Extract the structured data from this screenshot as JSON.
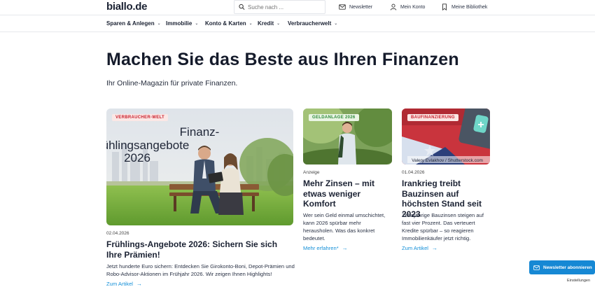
{
  "header": {
    "logo": "biallo.de",
    "search_placeholder": "Suche nach ...",
    "links": [
      {
        "label": "Newsletter",
        "icon": "mail-icon"
      },
      {
        "label": "Mein Konto",
        "icon": "user-icon"
      },
      {
        "label": "Meine Bibliothek",
        "icon": "bookmark-icon"
      }
    ]
  },
  "nav": [
    {
      "label": "Sparen & Anlegen"
    },
    {
      "label": "Immobilie"
    },
    {
      "label": "Konto & Karten"
    },
    {
      "label": "Kredit"
    },
    {
      "label": "Verbraucherwelt"
    }
  ],
  "hero": {
    "title": "Machen Sie das Beste aus Ihren Finanzen",
    "subtitle": "Ihr Online-Magazin für private Finanzen."
  },
  "articles": [
    {
      "badge": "VERBRAUCHER-WELT",
      "image_text": [
        "Finanz-",
        "ühlingsangebote",
        "2026"
      ],
      "date": "02.04.2026",
      "title": "Frühlings-Angebote 2026: Sichern Sie sich Ihre Prämien!",
      "teaser": "Jetzt hunderte Euro sichern: Entdecken Sie Girokonto-Boni, Depot-Prämien und Robo-Advisor-Aktionen im Frühjahr 2026. Wir zeigen Ihnen Highlights!",
      "link": "Zum Artikel"
    },
    {
      "badge": "GELDANLAGE 2026",
      "date": "Anzeige",
      "title": "Mehr Zinsen – mit etwas weniger Komfort",
      "teaser": "Wer sein Geld einmal umschichtet, kann 2026 spürbar mehr herausholen. Was das konkret bedeutet.",
      "link": "Mehr erfahren*"
    },
    {
      "badge": "BAUFINANZIERUNG",
      "image_credit": "Valery Evlakhov / Shutterstock.com",
      "date": "01.04.2026",
      "title": "Irankrieg treibt Bauzinsen auf höchsten Stand seit 2023",
      "teaser": "Zehnjährige Bauzinsen steigen auf fast vier Prozent. Das verteuert Kredite spürbar – so reagieren Immobilienkäufer jetzt richtig.",
      "link": "Zum Artikel"
    }
  ],
  "newsletter_button": "Newsletter abonnieren",
  "settings_link": "Einstellungen",
  "colors": {
    "accent": "#1590d8",
    "badge_green": "#2e8b3a",
    "badge_red": "#c8202d",
    "text": "#1b2233"
  }
}
